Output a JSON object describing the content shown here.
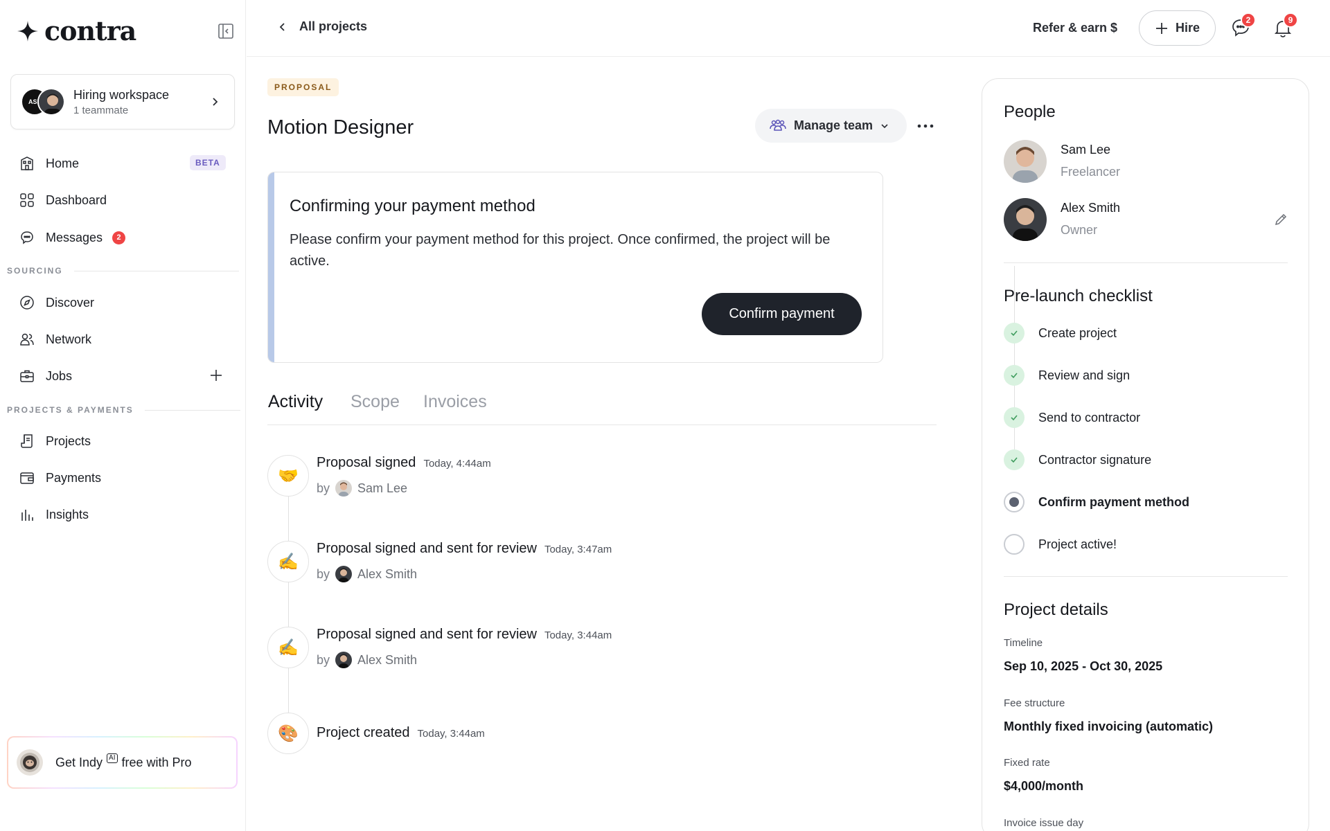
{
  "brand": {
    "name": "contra"
  },
  "workspace": {
    "title": "Hiring workspace",
    "subtitle": "1 teammate",
    "avatar_text": "ASL"
  },
  "nav": {
    "home": "Home",
    "home_badge": "BETA",
    "dashboard": "Dashboard",
    "messages": "Messages",
    "messages_count": "2",
    "section_sourcing": "SOURCING",
    "discover": "Discover",
    "network": "Network",
    "jobs": "Jobs",
    "section_projects": "PROJECTS & PAYMENTS",
    "projects": "Projects",
    "payments": "Payments",
    "insights": "Insights"
  },
  "promo": {
    "get": "Get Indy",
    "ai": "AI",
    "suffix": "free with Pro"
  },
  "topbar": {
    "back": "All projects",
    "refer": "Refer & earn $",
    "hire": "Hire",
    "messages_badge": "2",
    "notifications_badge": "9"
  },
  "project": {
    "tag": "PROPOSAL",
    "title": "Motion Designer",
    "manage_team": "Manage team"
  },
  "confirm": {
    "title": "Confirming your payment method",
    "body": "Please confirm your payment method for this project. Once confirmed, the project will be active.",
    "button": "Confirm payment"
  },
  "tabs": [
    "Activity",
    "Scope",
    "Invoices"
  ],
  "activity": [
    {
      "icon": "🤝",
      "title": "Proposal signed",
      "time": "Today, 4:44am",
      "by": "by",
      "name": "Sam Lee"
    },
    {
      "icon": "✍️",
      "title": "Proposal signed and sent for review",
      "time": "Today, 3:47am",
      "by": "by",
      "name": "Alex Smith"
    },
    {
      "icon": "✍️",
      "title": "Proposal signed and sent for review",
      "time": "Today, 3:44am",
      "by": "by",
      "name": "Alex Smith"
    },
    {
      "icon": "🎨",
      "title": "Project created",
      "time": "Today, 3:44am"
    }
  ],
  "people": {
    "heading": "People",
    "list": [
      {
        "name": "Sam Lee",
        "role": "Freelancer"
      },
      {
        "name": "Alex Smith",
        "role": "Owner"
      }
    ]
  },
  "checklist": {
    "heading": "Pre-launch checklist",
    "items": [
      {
        "label": "Create project",
        "state": "done"
      },
      {
        "label": "Review and sign",
        "state": "done"
      },
      {
        "label": "Send to contractor",
        "state": "done"
      },
      {
        "label": "Contractor signature",
        "state": "done"
      },
      {
        "label": "Confirm payment method",
        "state": "current"
      },
      {
        "label": "Project active!",
        "state": "todo"
      }
    ]
  },
  "details": {
    "heading": "Project details",
    "timeline_label": "Timeline",
    "timeline_value": "Sep 10, 2025 - Oct 30, 2025",
    "fee_label": "Fee structure",
    "fee_value": "Monthly fixed invoicing (automatic)",
    "rate_label": "Fixed rate",
    "rate_value": "$4,000/month",
    "issue_label": "Invoice issue day"
  },
  "colors": {
    "accent_dark": "#1f232b",
    "badge_red": "#ef4444",
    "confirm_bar": "#b8c9e8",
    "done_green": "#d9f2e0"
  }
}
